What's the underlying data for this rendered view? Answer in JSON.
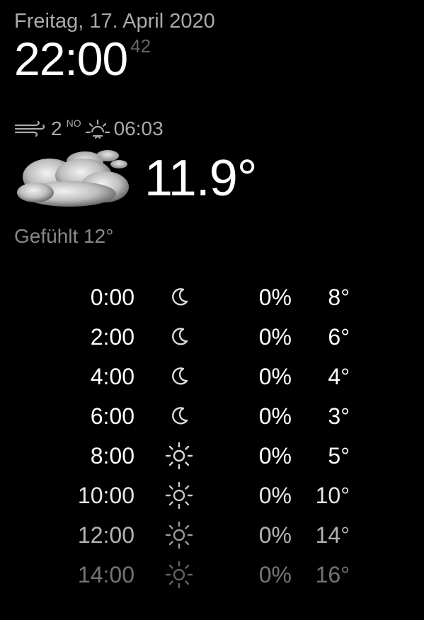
{
  "clock": {
    "date": "Freitag, 17. April 2020",
    "time": "22:00",
    "seconds": "42"
  },
  "current": {
    "wind_speed": "2",
    "wind_direction": "NO",
    "sunrise": "06:03",
    "temperature": "11.9°",
    "feels_like": "Gefühlt 12°",
    "icon": "cloudy-icon"
  },
  "forecast": [
    {
      "hour": "0:00",
      "icon": "moon-icon",
      "precip": "0%",
      "temp": "8°"
    },
    {
      "hour": "2:00",
      "icon": "moon-icon",
      "precip": "0%",
      "temp": "6°"
    },
    {
      "hour": "4:00",
      "icon": "moon-icon",
      "precip": "0%",
      "temp": "4°"
    },
    {
      "hour": "6:00",
      "icon": "moon-icon",
      "precip": "0%",
      "temp": "3°"
    },
    {
      "hour": "8:00",
      "icon": "sun-icon",
      "precip": "0%",
      "temp": "5°"
    },
    {
      "hour": "10:00",
      "icon": "sun-icon",
      "precip": "0%",
      "temp": "10°"
    },
    {
      "hour": "12:00",
      "icon": "sun-icon",
      "precip": "0%",
      "temp": "14°"
    },
    {
      "hour": "14:00",
      "icon": "sun-icon",
      "precip": "0%",
      "temp": "16°"
    }
  ],
  "colors": {
    "background": "#000000",
    "primary_text": "#ffffff",
    "dim_text": "#aaaaaa"
  }
}
